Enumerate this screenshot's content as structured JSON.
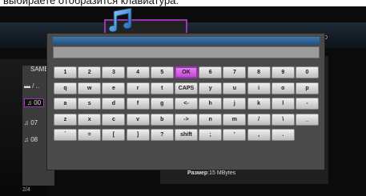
{
  "caption": "выбираете отобразится клавиатура:",
  "background": {
    "left_header": "SAMB",
    "right_label": "D",
    "file_rows": [
      {
        "icon": "folder-icon",
        "text": "/ .."
      },
      {
        "icon": "music-note-icon",
        "text": "00"
      },
      {
        "icon": "music-note-icon",
        "text": "07"
      },
      {
        "icon": "music-note-icon",
        "text": "08"
      }
    ],
    "pager": "2/4",
    "size_label": "Размер",
    "size_value": ":15 MBytes"
  },
  "dialog": {
    "title": "",
    "input_value": ""
  },
  "keyboard": {
    "rows": [
      [
        "1",
        "2",
        "3",
        "4",
        "5",
        "OK",
        "6",
        "7",
        "8",
        "9",
        "0"
      ],
      [
        "q",
        "w",
        "e",
        "r",
        "t",
        "CAPS",
        "y",
        "u",
        "i",
        "o",
        "p"
      ],
      [
        "a",
        "s",
        "d",
        "f",
        "g",
        "<-",
        "h",
        "j",
        "k",
        "l",
        "-"
      ],
      [
        "z",
        "x",
        "c",
        "v",
        "b",
        "->",
        "n",
        "m",
        "/",
        "\\",
        "_"
      ],
      [
        "`",
        "=",
        "[",
        "]",
        "?",
        "shift",
        ";",
        "'",
        ",",
        "."
      ]
    ],
    "highlighted": "OK"
  },
  "colors": {
    "accent": "#9a37b0",
    "title_bar": "#3a78b0",
    "dialog_bg": "#4a4a4a"
  }
}
